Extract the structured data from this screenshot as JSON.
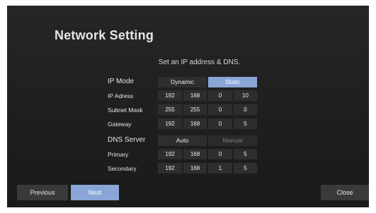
{
  "title": "Network Setting",
  "subtitle": "Set an IP address & DNS.",
  "ip_mode": {
    "label": "IP Mode",
    "options": [
      "Dynamic",
      "Static"
    ],
    "selected": "Static"
  },
  "ip_rows": [
    {
      "label": "IP Adress",
      "values": [
        "192",
        "168",
        "0",
        "10"
      ]
    },
    {
      "label": "Subnet Mask",
      "values": [
        "255",
        "255",
        "0",
        "0"
      ]
    },
    {
      "label": "Gateway",
      "values": [
        "192",
        "168",
        "0",
        "5"
      ]
    }
  ],
  "dns_server": {
    "label": "DNS Server",
    "options": [
      "Auto",
      "Manual"
    ],
    "selected": "Auto"
  },
  "dns_rows": [
    {
      "label": "Primary",
      "values": [
        "192",
        "168",
        "0",
        "5"
      ]
    },
    {
      "label": "Secondary",
      "values": [
        "192",
        "168",
        "1",
        "5"
      ]
    }
  ],
  "buttons": {
    "previous": "Previous",
    "next": "Next",
    "close": "Close"
  }
}
